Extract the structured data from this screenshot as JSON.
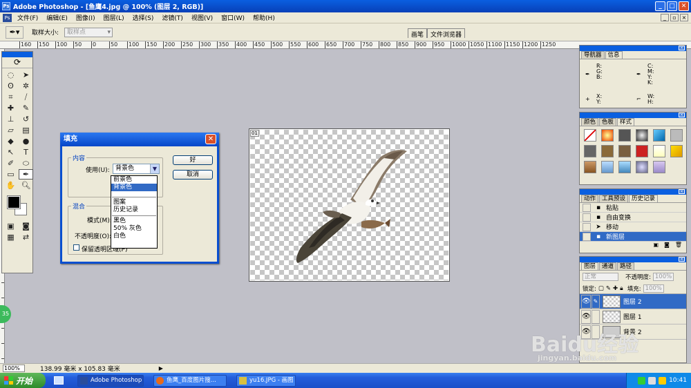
{
  "titlebar": {
    "title": "Adobe Photoshop - [鱼鹰4.jpg @ 100% (图层 2, RGB)]",
    "app_icon": "Ps"
  },
  "menubar": {
    "items": [
      "文件(F)",
      "编辑(E)",
      "图像(I)",
      "图层(L)",
      "选择(S)",
      "滤镜(T)",
      "视图(V)",
      "窗口(W)",
      "帮助(H)"
    ]
  },
  "options": {
    "sample_size_label": "取样大小:",
    "sample_size_value": "取样点"
  },
  "wells": {
    "brushes": "画笔",
    "file_browser": "文件浏览器"
  },
  "ruler": {
    "top": [
      "160",
      "150",
      "100",
      "50",
      "0",
      "50",
      "100",
      "150",
      "200",
      "250",
      "300",
      "350",
      "400",
      "450",
      "500",
      "550",
      "600",
      "650",
      "700",
      "750",
      "800",
      "850",
      "900",
      "950",
      "1000",
      "1050",
      "1100",
      "1150",
      "1200",
      "1250"
    ]
  },
  "document": {
    "badge": "01"
  },
  "fill_dialog": {
    "title": "填充",
    "content_legend": "内容",
    "use_label": "使用(U):",
    "use_value": "背景色",
    "ok_label": "好",
    "cancel_label": "取消",
    "blend_legend": "混合",
    "mode_label": "模式(M):",
    "opacity_label": "不透明度(O):",
    "preserve_label": "保留透明区域(P)",
    "options": [
      "前景色",
      "背景色",
      "图案",
      "历史记录",
      "黑色",
      "50% 灰色",
      "白色"
    ],
    "selected_option": "背景色"
  },
  "navigator_panel": {
    "tabs": [
      "导航器",
      "信息"
    ],
    "active_tab": "信息",
    "rgb": "R:\nG:\nB:",
    "cmyk": "C:\nM:\nY:\nK:",
    "xy": "X:\nY:",
    "wh": "W:\nH:"
  },
  "color_panel": {
    "tabs": [
      "颜色",
      "色板",
      "样式"
    ],
    "active_tab": "样式"
  },
  "history_panel": {
    "tabs": [
      "动作",
      "工具预设",
      "历史记录"
    ],
    "active_tab": "历史记录",
    "items": [
      "粘贴",
      "自由变换",
      "移动",
      "新图层"
    ],
    "selected": "新图层"
  },
  "layers_panel": {
    "tabs": [
      "图层",
      "通道",
      "路径"
    ],
    "active_tab": "图层",
    "blend_mode": "正常",
    "opacity_label": "不透明度:",
    "opacity_value": "100%",
    "lock_label": "锁定:",
    "fill_label": "填充:",
    "fill_value": "100%",
    "layers": [
      "图层 2",
      "图层 1",
      "背景 2"
    ],
    "selected": "图层 2"
  },
  "status": {
    "zoom": "100%",
    "doc_size": "138.99 毫米 x 105.83 毫米"
  },
  "taskbar": {
    "start": "开始",
    "items": [
      "Adobe Photoshop ...",
      "鱼鹰_百度图片搜...",
      "yu16.JPG - 画图"
    ],
    "clock": "10:41"
  },
  "watermark": {
    "brand": "Baidu经验",
    "url": "jingyan.baidu.com",
    "badge": "35"
  },
  "colors": {
    "xp_blue": "#0a5fe0",
    "selection": "#316ac5",
    "canvas_bg": "#c0c0c8"
  }
}
